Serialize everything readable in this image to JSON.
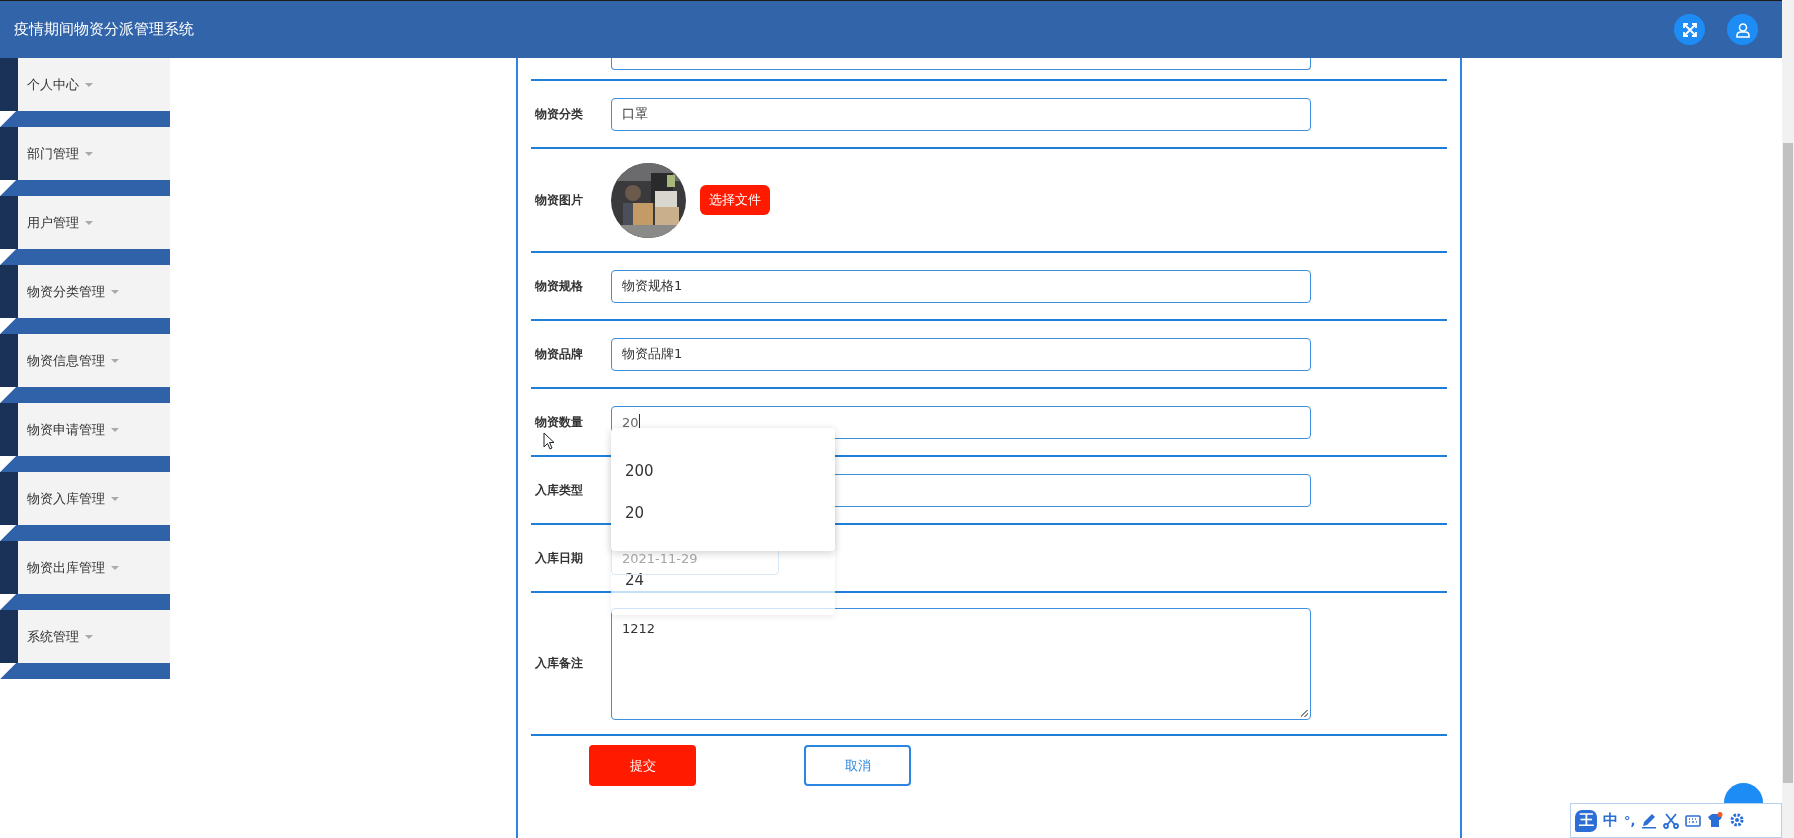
{
  "header": {
    "title": "疫情期间物资分派管理系统"
  },
  "sidebar": {
    "items": [
      {
        "label": "个人中心"
      },
      {
        "label": "部门管理"
      },
      {
        "label": "用户管理"
      },
      {
        "label": "物资分类管理"
      },
      {
        "label": "物资信息管理"
      },
      {
        "label": "物资申请管理"
      },
      {
        "label": "物资入库管理"
      },
      {
        "label": "物资出库管理"
      },
      {
        "label": "系统管理"
      }
    ]
  },
  "form": {
    "rows": [
      {
        "kind": "cut"
      },
      {
        "kind": "text",
        "label": "物资分类",
        "value": "口罩"
      },
      {
        "label": "物资图片",
        "button": "选择文件"
      },
      {
        "kind": "text",
        "label": "物资规格",
        "value": "物资规格1"
      },
      {
        "kind": "text",
        "label": "物资品牌",
        "value": "物资品牌1"
      },
      {
        "kind": "typing",
        "label": "物资数量",
        "value": "20"
      },
      {
        "kind": "text",
        "label": "入库类型"
      },
      {
        "kind": "date",
        "label": "入库日期",
        "placeholder": "2021-11-29"
      },
      {
        "kind": "textarea",
        "label": "入库备注",
        "value": "1212"
      }
    ],
    "buttons": [
      {
        "label": "提交",
        "kind": "primary"
      },
      {
        "label": "取消",
        "kind": "secondary"
      }
    ]
  },
  "autocomplete": {
    "options": [
      {
        "label": "200"
      },
      {
        "label": "20"
      }
    ]
  },
  "autocomplete_fading": {
    "options": [
      {
        "label": "24"
      }
    ]
  },
  "ime_toolbar": {
    "logo": "王",
    "mode": "中",
    "punctuation": "°,"
  }
}
